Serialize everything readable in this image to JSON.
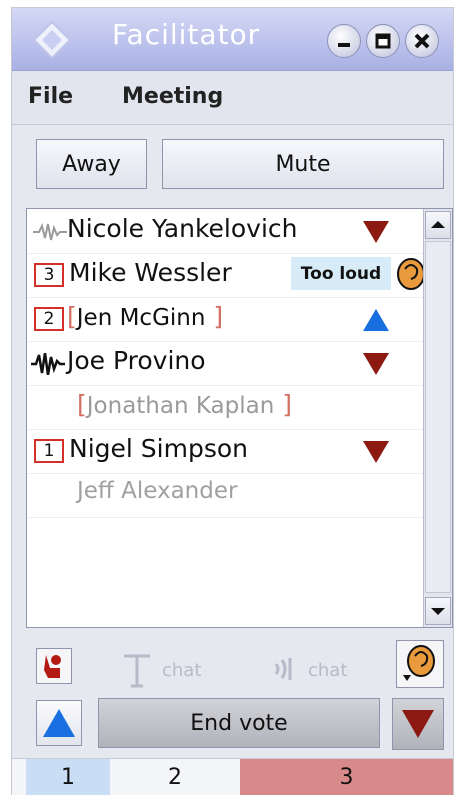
{
  "window": {
    "title": "Facilitator"
  },
  "menu": {
    "file": "File",
    "meeting": "Meeting"
  },
  "controls": {
    "away_label": "Away",
    "mute_label": "Mute"
  },
  "participants": [
    {
      "name": "Nicole Yankelovich",
      "speaking_icon": "waveform-small-icon",
      "vote": "down"
    },
    {
      "name": "Mike Wessler",
      "queue": "3",
      "status_tip": "Too loud",
      "status_icon": "ear-icon"
    },
    {
      "name": "Jen McGinn",
      "queue": "2",
      "muted": true,
      "vote": "up"
    },
    {
      "name": "Joe Provino",
      "speaking_icon": "waveform-large-icon",
      "vote": "down"
    },
    {
      "name": "Jonathan Kaplan",
      "muted": true,
      "inactive": true
    },
    {
      "name": "Nigel Simpson",
      "queue": "1",
      "vote": "down"
    },
    {
      "name": "Jeff Alexander",
      "inactive": true
    }
  ],
  "toolbar": {
    "text_chat_label": "chat",
    "voice_chat_label": "chat"
  },
  "vote": {
    "end_vote_label": "End vote",
    "tally": [
      {
        "label": "1",
        "color": "#c9ddf5"
      },
      {
        "label": "2",
        "color": "#f4f5f8"
      },
      {
        "label": "3",
        "color": "#d88a8a"
      }
    ]
  },
  "colors": {
    "vote_up": "#1a6fe0",
    "vote_down": "#8c1a12",
    "queue_border": "#d4302a",
    "bracket": "#d46e64"
  }
}
